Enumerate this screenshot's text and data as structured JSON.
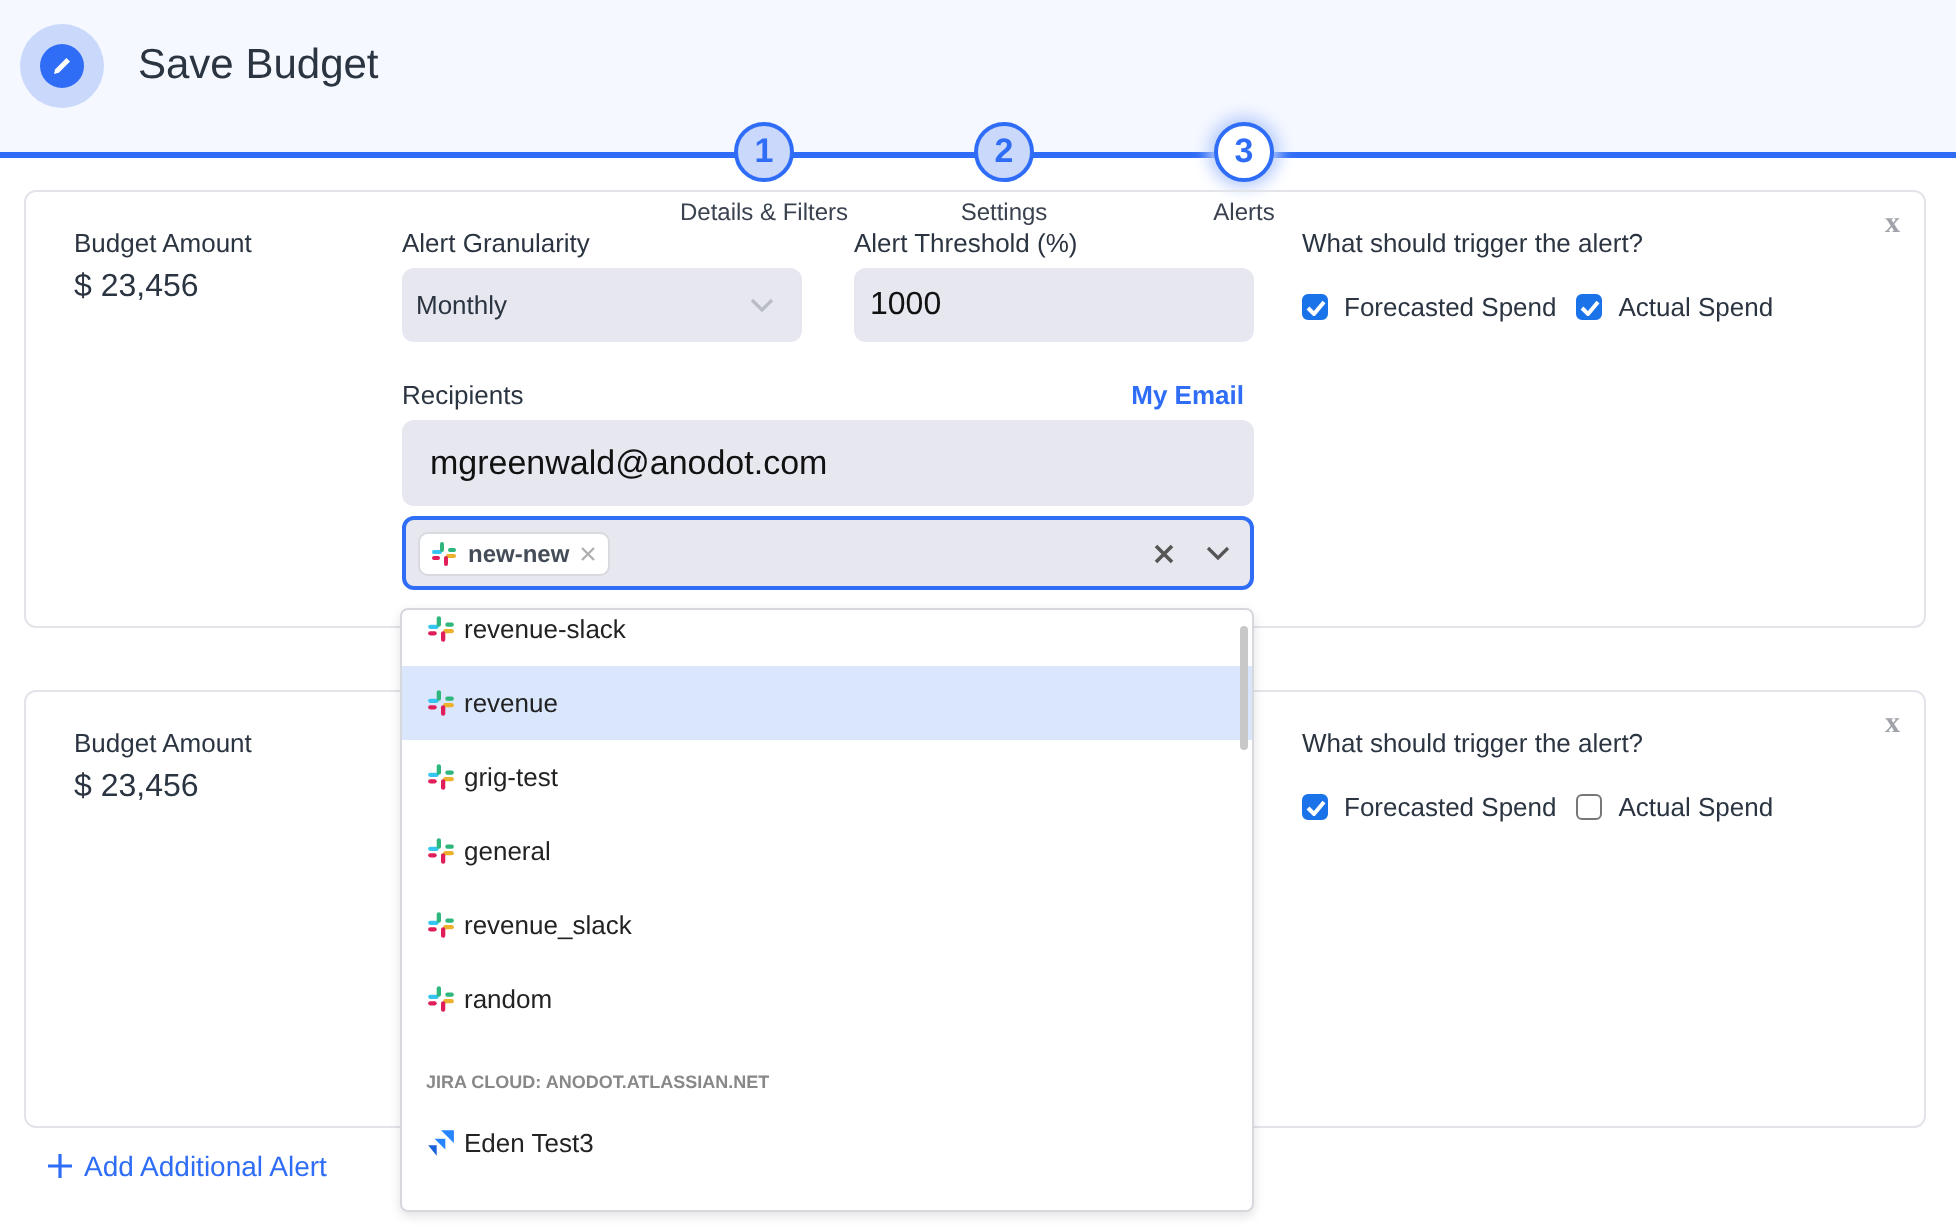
{
  "header": {
    "title": "Save Budget"
  },
  "steps": [
    {
      "number": "1",
      "label": "Details & Filters",
      "selected": false
    },
    {
      "number": "2",
      "label": "Settings",
      "selected": false
    },
    {
      "number": "3",
      "label": "Alerts",
      "selected": true
    }
  ],
  "alerts": [
    {
      "budget_label": "Budget Amount",
      "budget_value": "$ 23,456",
      "granularity": {
        "label": "Alert Granularity",
        "value": "Monthly"
      },
      "threshold": {
        "label": "Alert Threshold (%)",
        "value": "1000"
      },
      "recipients": {
        "label": "Recipients",
        "link": "My Email",
        "email": "mgreenwald@anodot.com",
        "tags": [
          "new-new"
        ],
        "focused": true
      },
      "trigger_label": "What should trigger the alert?",
      "triggers": [
        {
          "label": "Forecasted Spend",
          "checked": true
        },
        {
          "label": "Actual Spend",
          "checked": true
        }
      ],
      "close": "x"
    },
    {
      "budget_label": "Budget Amount",
      "budget_value": "$ 23,456",
      "trigger_label": "What should trigger the alert?",
      "triggers": [
        {
          "label": "Forecasted Spend",
          "checked": true
        },
        {
          "label": "Actual Spend",
          "checked": false
        }
      ],
      "close": "x"
    }
  ],
  "add_alert": "Add Additional Alert",
  "dropdown": {
    "items": [
      {
        "kind": "slack",
        "label": "revenue-slack",
        "selected": false
      },
      {
        "kind": "slack",
        "label": "revenue",
        "selected": true
      },
      {
        "kind": "slack",
        "label": "grig-test",
        "selected": false
      },
      {
        "kind": "slack",
        "label": "general",
        "selected": false
      },
      {
        "kind": "slack",
        "label": "revenue_slack",
        "selected": false
      },
      {
        "kind": "slack",
        "label": "random",
        "selected": false
      },
      {
        "kind": "group",
        "label": "JIRA CLOUD: ANODOT.ATLASSIAN.NET"
      },
      {
        "kind": "jira",
        "label": "Eden Test3",
        "selected": false
      }
    ]
  }
}
